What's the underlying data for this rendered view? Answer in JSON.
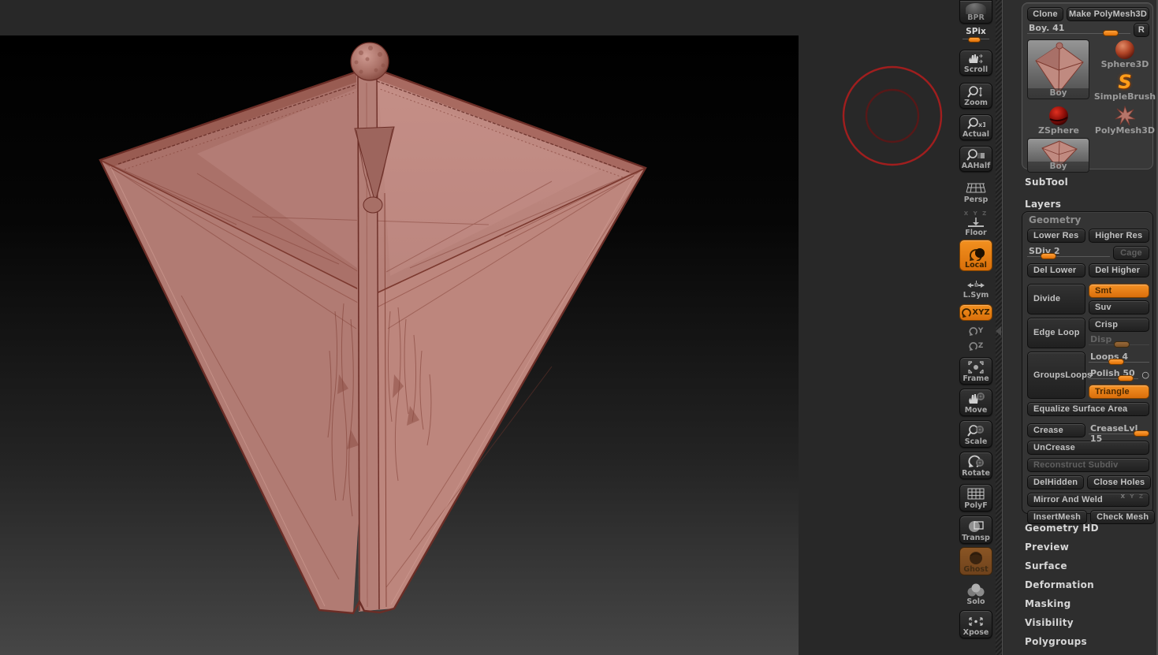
{
  "colors": {
    "accent_orange": "#ee7f16",
    "navigator_outer_red": "#a01e1e",
    "navigator_inner_red": "#571818",
    "mesh_pink": "#b5837c",
    "mesh_edge": "#6b2d26",
    "panel_bg": "#2e2e2e",
    "canvas_gradient_top": "#000000",
    "canvas_gradient_bottom": "#464646"
  },
  "shelf": {
    "items": [
      {
        "label": "BPR"
      },
      {
        "label": "SPix",
        "type": "slider",
        "value_pct": 40
      },
      {
        "label": "Scroll"
      },
      {
        "label": "Zoom"
      },
      {
        "label": "Actual"
      },
      {
        "label": "AAHalf"
      },
      {
        "label": "Persp"
      },
      {
        "label": "Floor",
        "axes": "X Y Z"
      },
      {
        "label": "Local",
        "active": true
      },
      {
        "label": "L.Sym"
      },
      {
        "label": "XYZ",
        "active": true
      },
      {
        "label": "Y"
      },
      {
        "label": "Z"
      },
      {
        "label": "Frame"
      },
      {
        "label": "Move"
      },
      {
        "label": "Scale"
      },
      {
        "label": "Rotate"
      },
      {
        "label": "PolyF"
      },
      {
        "label": "Transp"
      },
      {
        "label": "Ghost",
        "disabled": true
      },
      {
        "label": "Solo"
      },
      {
        "label": "Xpose"
      }
    ]
  },
  "tool": {
    "clone": "Clone",
    "make_polymesh": "Make PolyMesh3D",
    "tool_slider": {
      "label": "Boy. 41",
      "value": 41,
      "pct": 73
    },
    "restore": "R",
    "current_thumb": {
      "label": "Boy"
    },
    "thumbs": {
      "sphere3d": "Sphere3D",
      "simplebrush": "SimpleBrush",
      "simplebrush_glyph": "S",
      "zsphere": "ZSphere",
      "polymesh3d": "PolyMesh3D",
      "boy_small": "Boy"
    },
    "sections_top": [
      {
        "label": "SubTool"
      },
      {
        "label": "Layers"
      }
    ],
    "geometry": {
      "header": "Geometry",
      "lower_res": "Lower Res",
      "higher_res": "Higher Res",
      "sdiv": {
        "label": "SDiv 2",
        "value": 2,
        "pct": 16
      },
      "cage": "Cage",
      "del_lower": "Del Lower",
      "del_higher": "Del Higher",
      "divide": "Divide",
      "smt": "Smt",
      "suv": "Suv",
      "edge_loop": "Edge Loop",
      "crisp": "Crisp",
      "disp": {
        "label": "Disp",
        "pct": 42
      },
      "groups_loops": "GroupsLoops",
      "loops": {
        "label": "Loops 4",
        "value": 4,
        "pct": 33
      },
      "polish": {
        "label": "Polish 50",
        "value": 50,
        "pct": 48,
        "modifier": "○"
      },
      "triangle": "Triangle",
      "equalize": "Equalize Surface Area",
      "crease": "Crease",
      "crease_lvl": {
        "label": "CreaseLvl 15",
        "value": 15,
        "pct": 92
      },
      "uncrease": "UnCrease",
      "reconstruct": "Reconstruct Subdiv",
      "del_hidden": "DelHidden",
      "close_holes": "Close Holes",
      "mirror_weld": "Mirror And Weld",
      "mirror_axes": {
        "x": "X",
        "y": "Y",
        "z": "Z"
      },
      "insert_mesh": "InsertMesh",
      "check_mesh": "Check Mesh"
    },
    "sections_bottom": [
      {
        "label": "Geometry HD"
      },
      {
        "label": "Preview"
      },
      {
        "label": "Surface"
      },
      {
        "label": "Deformation"
      },
      {
        "label": "Masking"
      },
      {
        "label": "Visibility"
      },
      {
        "label": "Polygroups"
      }
    ]
  }
}
